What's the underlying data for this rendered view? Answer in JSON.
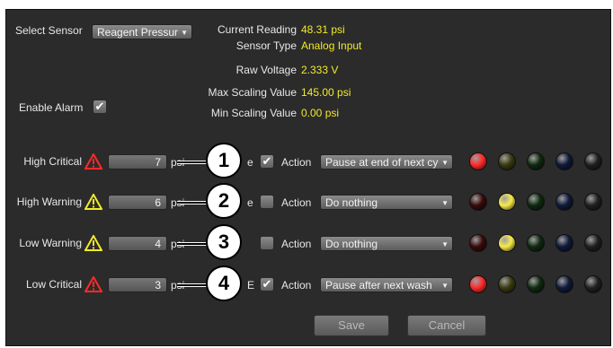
{
  "top": {
    "select_sensor_label": "Select Sensor",
    "sensor_value": "Reagent Pressur",
    "enable_alarm_label": "Enable Alarm",
    "enable_alarm_checked": true
  },
  "readings": {
    "current_reading_label": "Current Reading",
    "current_reading_value": "48.31 psi",
    "sensor_type_label": "Sensor Type",
    "sensor_type_value": "Analog Input",
    "raw_voltage_label": "Raw Voltage",
    "raw_voltage_value": "2.333 V",
    "max_scaling_label": "Max Scaling Value",
    "max_scaling_value": "145.00 psi",
    "min_scaling_label": "Min Scaling Value",
    "min_scaling_value": "0.00 psi"
  },
  "alarms": [
    {
      "label": "High Critical",
      "icon": "warning-red",
      "value": "7",
      "unit": "psi",
      "enable_fragment": "e",
      "enabled": true,
      "action_label": "Action",
      "action": "Pause at end of next cy",
      "callout": "1",
      "leds": [
        "#ff2a2a",
        "#3a3a10",
        "#0f2a10",
        "#0f1a3a",
        "#202020"
      ]
    },
    {
      "label": "High Warning",
      "icon": "warning-yellow",
      "value": "6",
      "unit": "psi",
      "enable_fragment": "e",
      "enabled": false,
      "action_label": "Action",
      "action": "Do nothing",
      "callout": "2",
      "leds": [
        "#3a0a0a",
        "#f6ea4a",
        "#0f2a10",
        "#0f1a3a",
        "#202020"
      ]
    },
    {
      "label": "Low Warning",
      "icon": "warning-yellow",
      "value": "4",
      "unit": "psi",
      "enable_fragment": "",
      "enabled": false,
      "action_label": "Action",
      "action": "Do nothing",
      "callout": "3",
      "leds": [
        "#3a0a0a",
        "#f6ea4a",
        "#0f2a10",
        "#0f1a3a",
        "#202020"
      ]
    },
    {
      "label": "Low Critical",
      "icon": "warning-red",
      "value": "3",
      "unit": "psi",
      "enable_fragment": "E",
      "enabled": true,
      "action_label": "Action",
      "action": "Pause after next wash",
      "callout": "4",
      "leds": [
        "#ff2a2a",
        "#3a3a10",
        "#0f2a10",
        "#0f1a3a",
        "#202020"
      ]
    }
  ],
  "buttons": {
    "save": "Save",
    "cancel": "Cancel"
  }
}
